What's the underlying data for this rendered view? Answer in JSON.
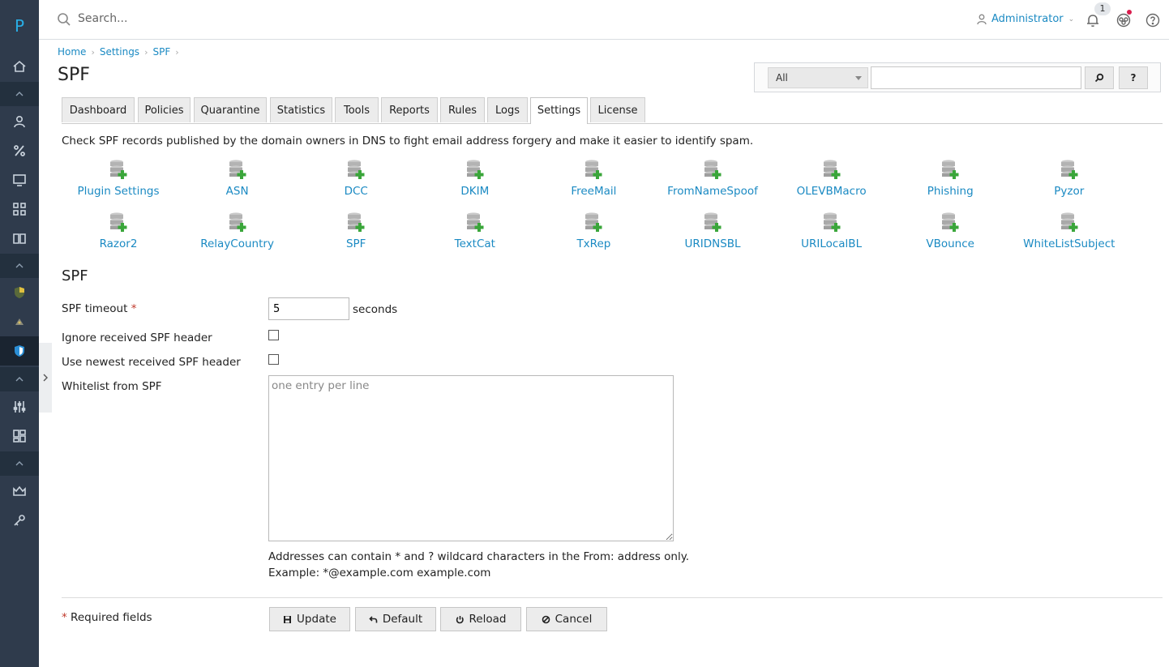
{
  "app": {
    "logo_letter": "P"
  },
  "topbar": {
    "search_placeholder": "Search...",
    "user_name": "Administrator",
    "notification_count": "1"
  },
  "breadcrumb": [
    "Home",
    "Settings",
    "SPF"
  ],
  "page_title": "SPF",
  "filter": {
    "select_value": "All",
    "input_value": "",
    "help_label": "?"
  },
  "tabs": [
    "Dashboard",
    "Policies",
    "Quarantine",
    "Statistics",
    "Tools",
    "Reports",
    "Rules",
    "Logs",
    "Settings",
    "License"
  ],
  "active_tab": "Settings",
  "description": "Check SPF records published by the domain owners in DNS to fight email address forgery and make it easier to identify spam.",
  "plugins_row1": [
    "Plugin Settings",
    "ASN",
    "DCC",
    "DKIM",
    "FreeMail",
    "FromNameSpoof",
    "OLEVBMacro",
    "Phishing",
    "Pyzor"
  ],
  "plugins_row2": [
    "Razor2",
    "RelayCountry",
    "SPF",
    "TextCat",
    "TxRep",
    "URIDNSBL",
    "URILocalBL",
    "VBounce",
    "WhiteListSubject"
  ],
  "form": {
    "section_title": "SPF",
    "timeout_label": "SPF timeout",
    "required_mark": "*",
    "timeout_value": "5",
    "timeout_unit": "seconds",
    "ignore_label": "Ignore received SPF header",
    "newest_label": "Use newest received SPF header",
    "whitelist_label": "Whitelist from SPF",
    "whitelist_placeholder": "one entry per line",
    "hint_line1": "Addresses can contain * and ? wildcard characters in the From: address only.",
    "hint_line2": "Example: *@example.com example.com",
    "required_note": "Required fields"
  },
  "buttons": {
    "update": "Update",
    "default": "Default",
    "reload": "Reload",
    "cancel": "Cancel"
  },
  "colors": {
    "sidebar": "#2f3b4c",
    "link": "#1b8ac3",
    "accent_dot": "#d91c4d"
  }
}
